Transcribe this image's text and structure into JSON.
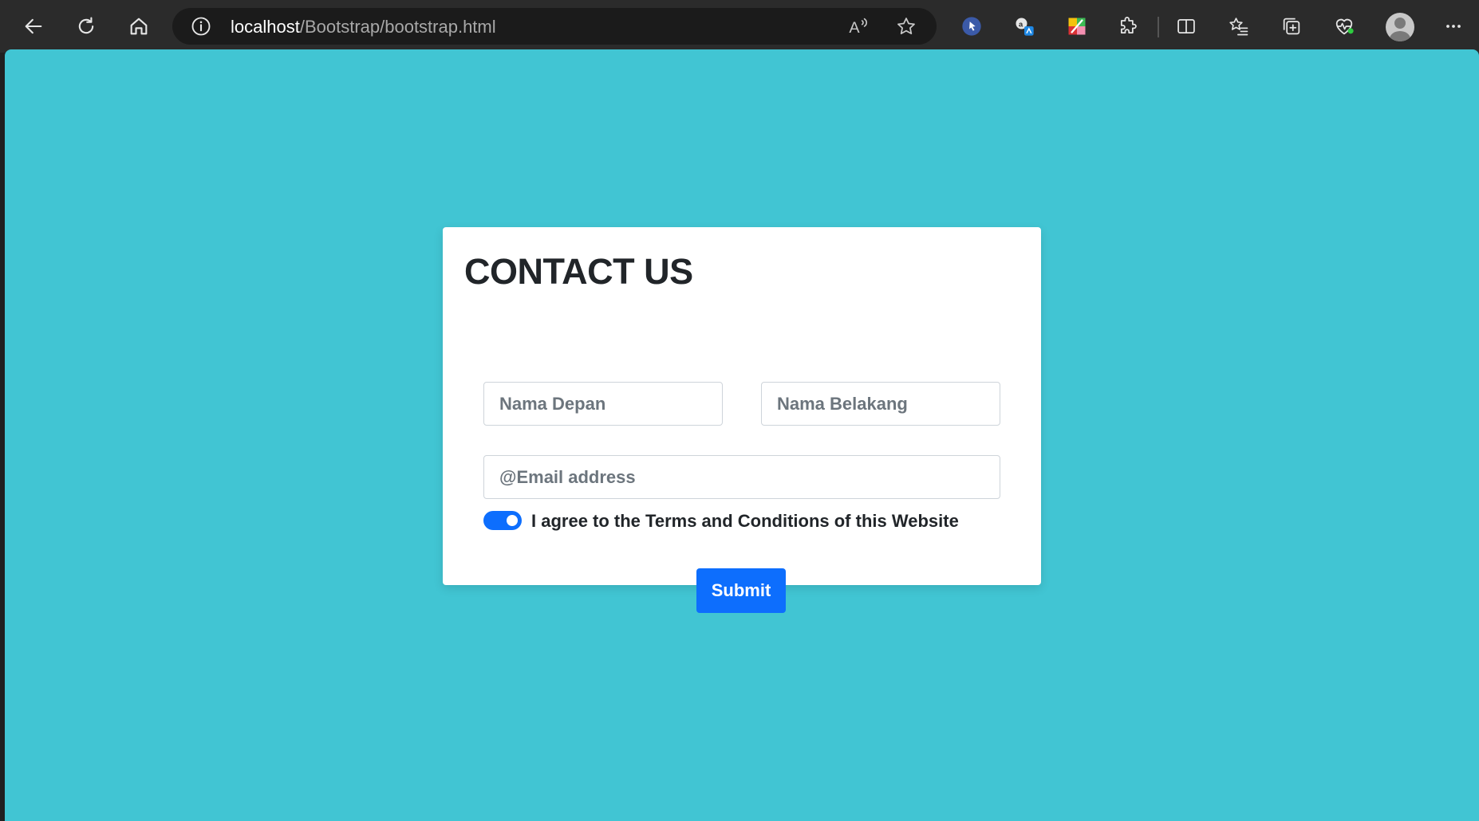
{
  "browser": {
    "url_host": "localhost",
    "url_path": "/Bootstrap/bootstrap.html"
  },
  "page": {
    "background_color": "#41c5d3",
    "accent_color": "#0d6efd"
  },
  "form": {
    "title": "CONTACT US",
    "first_name_placeholder": "Nama Depan",
    "last_name_placeholder": "Nama Belakang",
    "email_placeholder": "@Email address",
    "agree_label": "I agree to the Terms and Conditions of this Website",
    "agree_checked": true,
    "submit_label": "Submit"
  }
}
